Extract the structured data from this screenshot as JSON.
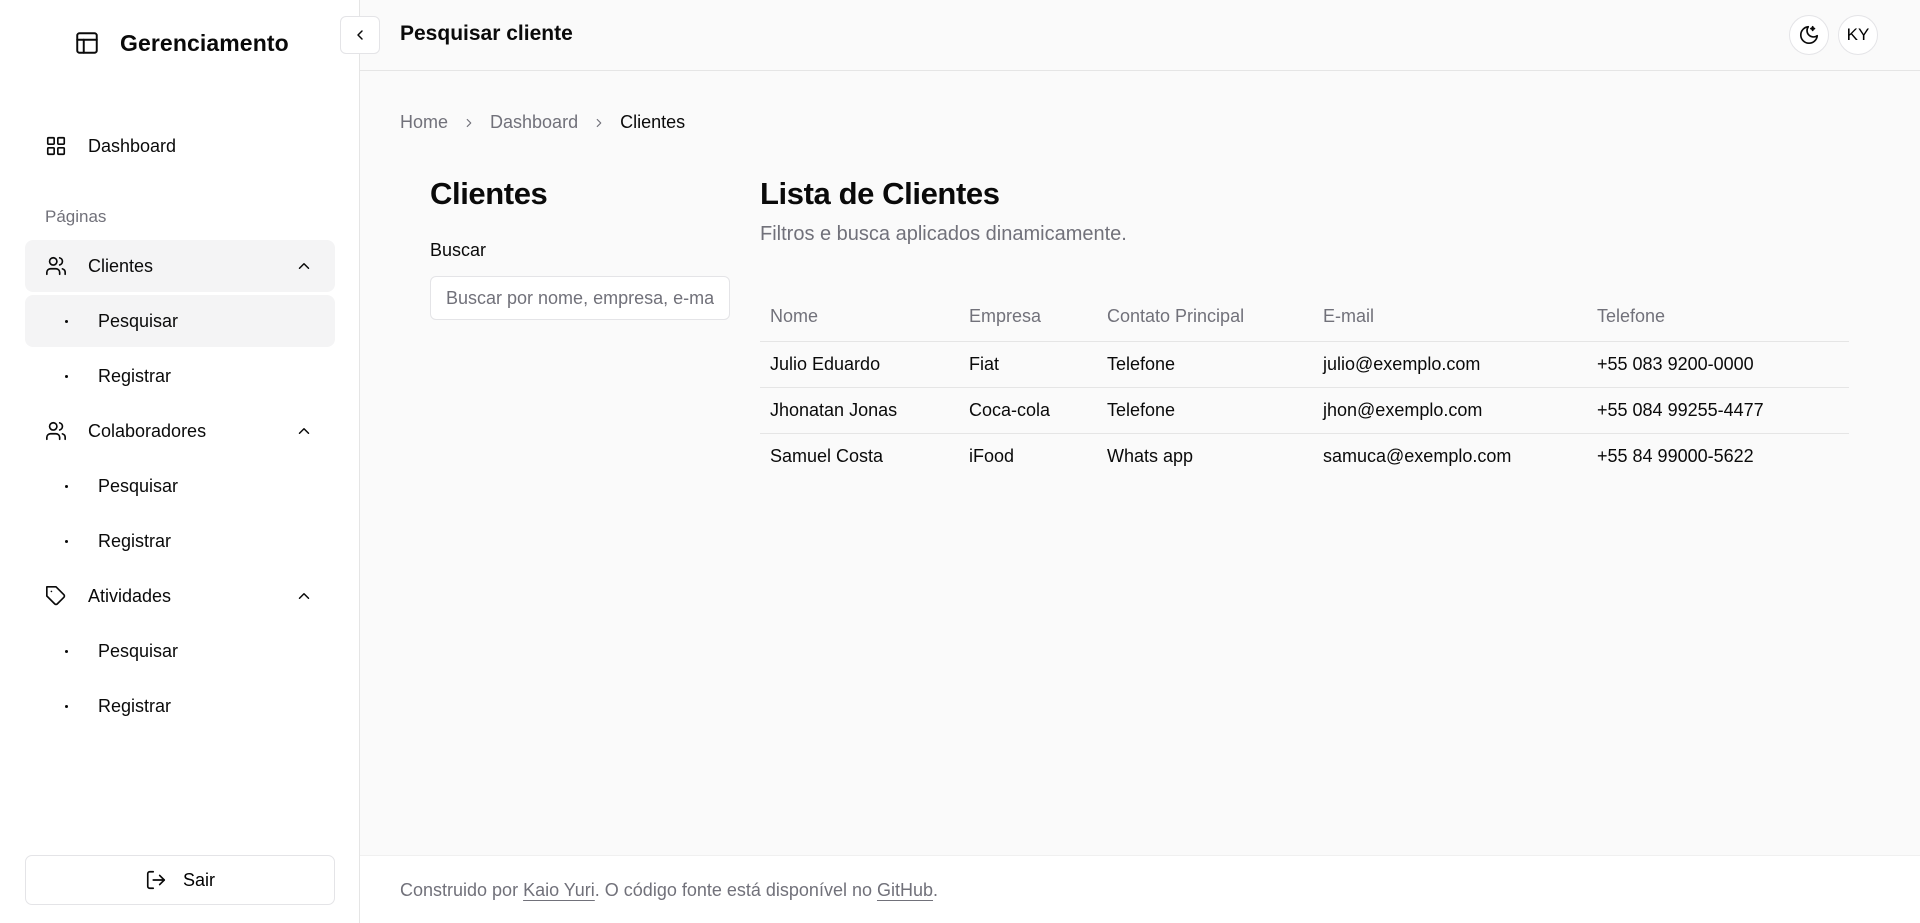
{
  "sidebar": {
    "brand": "Gerenciamento",
    "dashboard_label": "Dashboard",
    "section_label": "Páginas",
    "groups": [
      {
        "label": "Clientes",
        "icon": "users-icon",
        "items": [
          "Pesquisar",
          "Registrar"
        ]
      },
      {
        "label": "Colaboradores",
        "icon": "users-icon",
        "items": [
          "Pesquisar",
          "Registrar"
        ]
      },
      {
        "label": "Atividades",
        "icon": "tag-icon",
        "items": [
          "Pesquisar",
          "Registrar"
        ]
      }
    ],
    "logout_label": "Sair"
  },
  "header": {
    "title": "Pesquisar cliente",
    "avatar_initials": "KY"
  },
  "breadcrumb": [
    "Home",
    "Dashboard",
    "Clientes"
  ],
  "filters": {
    "title": "Clientes",
    "search_label": "Buscar",
    "search_placeholder": "Buscar por nome, empresa, e-mail..."
  },
  "list": {
    "title": "Lista de Clientes",
    "subtitle": "Filtros e busca aplicados dinamicamente.",
    "columns": [
      "Nome",
      "Empresa",
      "Contato Principal",
      "E-mail",
      "Telefone"
    ],
    "rows": [
      [
        "Julio Eduardo",
        "Fiat",
        "Telefone",
        "julio@exemplo.com",
        "+55 083 9200-0000"
      ],
      [
        "Jhonatan Jonas",
        "Coca-cola",
        "Telefone",
        "jhon@exemplo.com",
        "+55 084 99255-4477"
      ],
      [
        "Samuel Costa",
        "iFood",
        "Whats app",
        "samuca@exemplo.com",
        "+55 84 99000-5622"
      ]
    ]
  },
  "footer": {
    "prefix": "Construido por ",
    "author": "Kaio Yuri",
    "middle": ". O código fonte está disponível no ",
    "repo": "GitHub",
    "suffix": "."
  },
  "colors": {
    "muted_text": "#71717a",
    "active_bg": "#f4f4f5",
    "border": "#e4e4e7"
  }
}
